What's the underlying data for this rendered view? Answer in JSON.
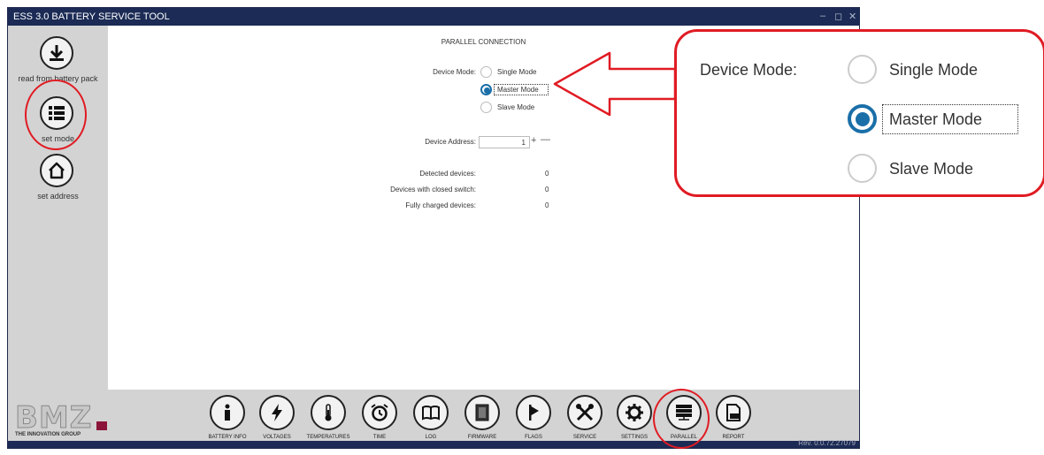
{
  "window": {
    "title": "ESS 3.0 BATTERY SERVICE TOOL",
    "minimize_glyph": "‒",
    "maximize_glyph": "◻",
    "close_glyph": "✕",
    "version": "Rev. 0.0.72.27079"
  },
  "sidebar": {
    "items": [
      {
        "label": "read from battery pack",
        "icon": "download-icon"
      },
      {
        "label": "set mode",
        "icon": "list-icon"
      },
      {
        "label": "set address",
        "icon": "home-icon"
      }
    ]
  },
  "panel": {
    "title": "PARALLEL CONNECTION",
    "device_mode_label": "Device Mode:",
    "modes": [
      {
        "label": "Single Mode",
        "selected": false
      },
      {
        "label": "Master Mode",
        "selected": true
      },
      {
        "label": "Slave Mode",
        "selected": false
      }
    ],
    "device_address_label": "Device Address:",
    "device_address_value": "1",
    "plus_glyph": "+",
    "minus_glyph": "—",
    "stats": [
      {
        "label": "Detected devices:",
        "value": "0"
      },
      {
        "label": "Devices with closed switch:",
        "value": "0"
      },
      {
        "label": "Fully charged devices:",
        "value": "0"
      }
    ]
  },
  "logo": {
    "text": "BMZ",
    "tagline": "THE INNOVATION GROUP"
  },
  "toolbar": {
    "items": [
      {
        "label": "BATTERY INFO",
        "icon": "info-icon"
      },
      {
        "label": "VOLTAGES",
        "icon": "lightning-icon"
      },
      {
        "label": "TEMPERATURES",
        "icon": "thermometer-icon"
      },
      {
        "label": "TIME",
        "icon": "alarm-clock-icon"
      },
      {
        "label": "LOG",
        "icon": "book-icon"
      },
      {
        "label": "FIRMWARE",
        "icon": "chip-icon"
      },
      {
        "label": "FLAGS",
        "icon": "flag-icon"
      },
      {
        "label": "SERVICE",
        "icon": "tools-icon"
      },
      {
        "label": "SETTINGS",
        "icon": "gear-icon"
      },
      {
        "label": "PARALLEL",
        "icon": "server-icon"
      },
      {
        "label": "REPORT",
        "icon": "pdf-icon"
      }
    ]
  },
  "zoom": {
    "device_mode_label": "Device Mode:",
    "modes": [
      "Single Mode",
      "Master Mode",
      "Slave Mode"
    ]
  },
  "colors": {
    "titlebar": "#1b2b55",
    "accent": "#1a6fa8",
    "annotation": "#e01b23",
    "logo_square": "#8b1538"
  }
}
